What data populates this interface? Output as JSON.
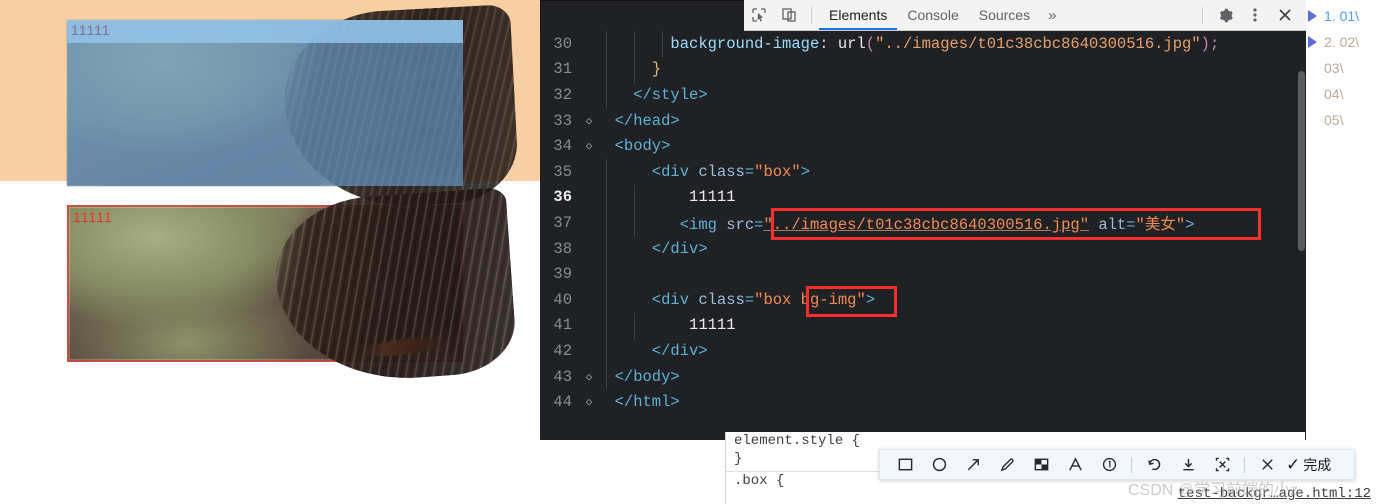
{
  "page": {
    "box_label_1": "11111",
    "box_label_2": "11111"
  },
  "playlist": {
    "items": [
      {
        "label": "1. 01\\"
      },
      {
        "label": "2. 02\\"
      },
      {
        "label": "03\\"
      },
      {
        "label": "04\\"
      },
      {
        "label": "05\\"
      }
    ]
  },
  "devtools": {
    "toolbar": {
      "inspect_icon": "inspect-element-icon",
      "device_icon": "device-toolbar-icon",
      "tabs": [
        {
          "label": "Elements",
          "active": true
        },
        {
          "label": "Console",
          "active": false
        },
        {
          "label": "Sources",
          "active": false
        }
      ],
      "more_tabs": "»",
      "settings_icon": "gear-icon",
      "menu_icon": "kebab-menu-icon",
      "close_icon": "close-icon"
    },
    "code": {
      "lines": [
        {
          "num": "30",
          "fold": "",
          "indent": 5,
          "highlight": false,
          "tokens": [
            {
              "t": "        ",
              "c": "tok-plain"
            },
            {
              "t": "background-image",
              "c": "tok-prop"
            },
            {
              "t": ": ",
              "c": "tok-punc"
            },
            {
              "t": "url",
              "c": "tok-plain"
            },
            {
              "t": "(",
              "c": "tok-paren"
            },
            {
              "t": "\"../images/t01c38cbc8640300516.jpg\"",
              "c": "tok-strl"
            },
            {
              "t": ")",
              "c": "tok-paren"
            },
            {
              "t": ";",
              "c": "tok-paren"
            }
          ]
        },
        {
          "num": "31",
          "fold": "",
          "indent": 4,
          "highlight": false,
          "tokens": [
            {
              "t": "      }",
              "c": "tok-brace"
            }
          ]
        },
        {
          "num": "32",
          "fold": "",
          "indent": 3,
          "highlight": false,
          "tokens": [
            {
              "t": "    </style>",
              "c": "tok-tag"
            }
          ]
        },
        {
          "num": "33",
          "fold": "◇",
          "indent": 1,
          "highlight": false,
          "tokens": [
            {
              "t": "  </head>",
              "c": "tok-tag"
            }
          ]
        },
        {
          "num": "34",
          "fold": "◇",
          "indent": 1,
          "highlight": false,
          "tokens": [
            {
              "t": "  <body>",
              "c": "tok-tag"
            }
          ]
        },
        {
          "num": "35",
          "fold": "",
          "indent": 2,
          "highlight": false,
          "tokens": [
            {
              "t": "      <div ",
              "c": "tok-tag"
            },
            {
              "t": "class",
              "c": "tok-attr"
            },
            {
              "t": "=",
              "c": "tok-tag"
            },
            {
              "t": "\"box\"",
              "c": "tok-str"
            },
            {
              "t": ">",
              "c": "tok-tag"
            }
          ]
        },
        {
          "num": "36",
          "fold": "",
          "indent": 3,
          "highlight": true,
          "tokens": [
            {
              "t": "          11111",
              "c": "tok-plain"
            }
          ]
        },
        {
          "num": "37",
          "fold": "",
          "indent": 3,
          "highlight": false,
          "tokens": [
            {
              "t": "         <img ",
              "c": "tok-tag"
            },
            {
              "t": "src",
              "c": "tok-attr"
            },
            {
              "t": "=",
              "c": "tok-tag"
            },
            {
              "t": "\"../images/t01c38cbc8640300516.jpg\"",
              "c": "tok-str url-underline"
            },
            {
              "t": " alt",
              "c": "tok-attr"
            },
            {
              "t": "=",
              "c": "tok-tag"
            },
            {
              "t": "\"美女\"",
              "c": "tok-cn"
            },
            {
              "t": ">",
              "c": "tok-tag"
            }
          ]
        },
        {
          "num": "38",
          "fold": "",
          "indent": 2,
          "highlight": false,
          "tokens": [
            {
              "t": "      </div>",
              "c": "tok-tag"
            }
          ]
        },
        {
          "num": "39",
          "fold": "",
          "indent": 2,
          "highlight": false,
          "tokens": [
            {
              "t": "",
              "c": "tok-plain"
            }
          ]
        },
        {
          "num": "40",
          "fold": "",
          "indent": 2,
          "highlight": false,
          "tokens": [
            {
              "t": "      <div ",
              "c": "tok-tag"
            },
            {
              "t": "class",
              "c": "tok-attr"
            },
            {
              "t": "=",
              "c": "tok-tag"
            },
            {
              "t": "\"box bg-img\"",
              "c": "tok-str"
            },
            {
              "t": ">",
              "c": "tok-tag"
            }
          ]
        },
        {
          "num": "41",
          "fold": "",
          "indent": 3,
          "highlight": false,
          "tokens": [
            {
              "t": "          11111",
              "c": "tok-plain"
            }
          ]
        },
        {
          "num": "42",
          "fold": "",
          "indent": 2,
          "highlight": false,
          "tokens": [
            {
              "t": "      </div>",
              "c": "tok-tag"
            }
          ]
        },
        {
          "num": "43",
          "fold": "◇",
          "indent": 1,
          "highlight": false,
          "tokens": [
            {
              "t": "  </body>",
              "c": "tok-tag"
            }
          ]
        },
        {
          "num": "44",
          "fold": "◇",
          "indent": 0,
          "highlight": false,
          "tokens": [
            {
              "t": "  </html>",
              "c": "tok-tag"
            }
          ]
        }
      ]
    },
    "styles": {
      "rule_element_style": "element.style {",
      "rule_element_close": "}",
      "rule_box": ".box {",
      "source_link": "test-backgr…age.html:12"
    }
  },
  "annotation_toolbar": {
    "tools": [
      {
        "icon": "rectangle-icon"
      },
      {
        "icon": "ellipse-icon"
      },
      {
        "icon": "arrow-icon"
      },
      {
        "icon": "pencil-icon"
      },
      {
        "icon": "mosaic-icon"
      },
      {
        "icon": "text-icon"
      },
      {
        "icon": "step-number-icon"
      }
    ],
    "actions": [
      {
        "icon": "undo-icon"
      },
      {
        "icon": "download-icon"
      },
      {
        "icon": "ocr-icon"
      }
    ],
    "close_icon": "close-icon",
    "done_check": "✓",
    "done_label": "完成"
  },
  "watermark": {
    "text": "CSDN @学习前端的小z"
  },
  "colors": {
    "page_background": "#f8cfa2",
    "inspector_overlay": "#6fa8dc",
    "annotation_red": "#ff2d2d",
    "devtools_bg": "#202124",
    "accent_blue": "#1a73e8"
  }
}
